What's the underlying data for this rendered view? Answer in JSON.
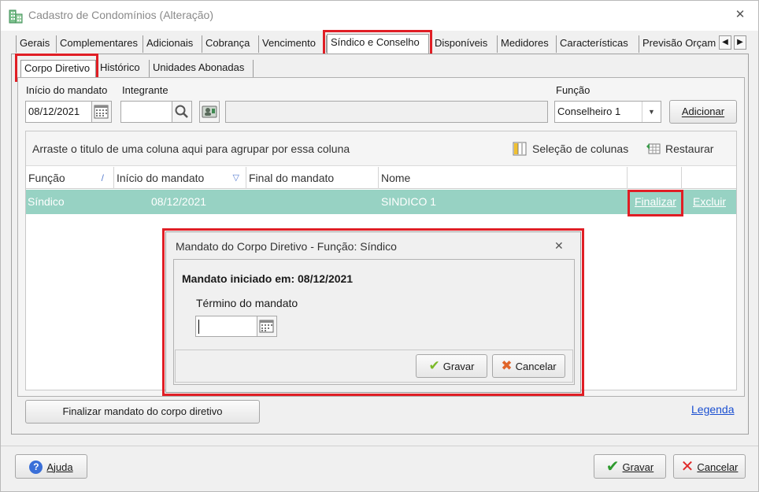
{
  "window": {
    "title": "Cadastro de Condomínios (Alteração)",
    "icon": "building-icon",
    "close_glyph": "✕"
  },
  "main_tabs": [
    {
      "label": "Gerais"
    },
    {
      "label": "Complementares"
    },
    {
      "label": "Adicionais"
    },
    {
      "label": "Cobrança"
    },
    {
      "label": "Vencimento"
    },
    {
      "label": "Síndico e Conselho",
      "active": true
    },
    {
      "label": "Disponíveis"
    },
    {
      "label": "Medidores"
    },
    {
      "label": "Características"
    },
    {
      "label": "Previsão Orçam"
    }
  ],
  "tab_scroll": {
    "left": "◀",
    "right": "▶"
  },
  "sub_tabs": [
    {
      "label": "Corpo Diretivo",
      "active": true
    },
    {
      "label": "Histórico"
    },
    {
      "label": "Unidades Abonadas"
    }
  ],
  "form": {
    "inicio_label": "Início do mandato",
    "inicio_value": "08/12/2021",
    "integrante_label": "Integrante",
    "integrante_value": "",
    "integrante_name_value": "",
    "funcao_label": "Função",
    "funcao_value": "Conselheiro 1",
    "adicionar_label": "Adicionar"
  },
  "grid": {
    "group_hint": "Arraste o titulo de uma coluna aqui para agrupar por essa coluna",
    "selecao_colunas": "Seleção de colunas",
    "restaurar": "Restaurar",
    "columns": [
      "Função",
      "Início do mandato",
      "Final do mandato",
      "Nome"
    ],
    "sort_glyph": "/",
    "filter_glyph": "▽",
    "rows": [
      {
        "funcao": "Síndico",
        "inicio": "08/12/2021",
        "final": "",
        "nome": "SINDICO 1",
        "finalizar": "Finalizar",
        "excluir": "Excluir"
      }
    ]
  },
  "dialog": {
    "title": "Mandato do Corpo Diretivo - Função: Síndico",
    "close_glyph": "✕",
    "iniciado": "Mandato iniciado em: 08/12/2021",
    "termino_label": "Término do mandato",
    "termino_value": "",
    "gravar": "Gravar",
    "cancelar": "Cancelar"
  },
  "finalizar_corpo_label": "Finalizar mandato do corpo diretivo",
  "legenda_label": "Legenda",
  "footer": {
    "ajuda": "Ajuda",
    "gravar": "Gravar",
    "cancelar": "Cancelar"
  },
  "colors": {
    "highlight_red": "#e01e25",
    "row_selected": "#97d2c3",
    "link_blue": "#1a4fd1"
  }
}
